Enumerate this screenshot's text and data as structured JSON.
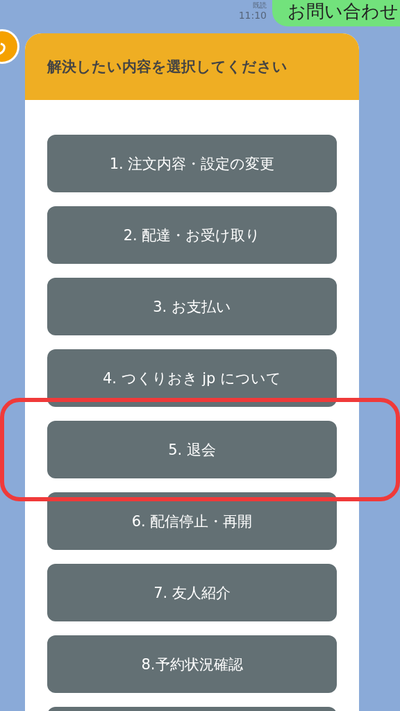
{
  "outgoing_message": {
    "text": "お問い合わせ",
    "read_label": "既読",
    "time": "11:10"
  },
  "menu_card": {
    "title": "解決したい内容を選択してください",
    "options": [
      {
        "label": "1. 注文内容・設定の変更",
        "highlighted": false
      },
      {
        "label": "2. 配達・お受け取り",
        "highlighted": false
      },
      {
        "label": "3. お支払い",
        "highlighted": false
      },
      {
        "label": "4. つくりおき jp について",
        "highlighted": false
      },
      {
        "label": "5. 退会",
        "highlighted": true
      },
      {
        "label": "6. 配信停止・再開",
        "highlighted": false
      },
      {
        "label": "7. 友人紹介",
        "highlighted": false
      },
      {
        "label": "8.予約状況確認",
        "highlighted": false
      }
    ],
    "more_below": true
  }
}
